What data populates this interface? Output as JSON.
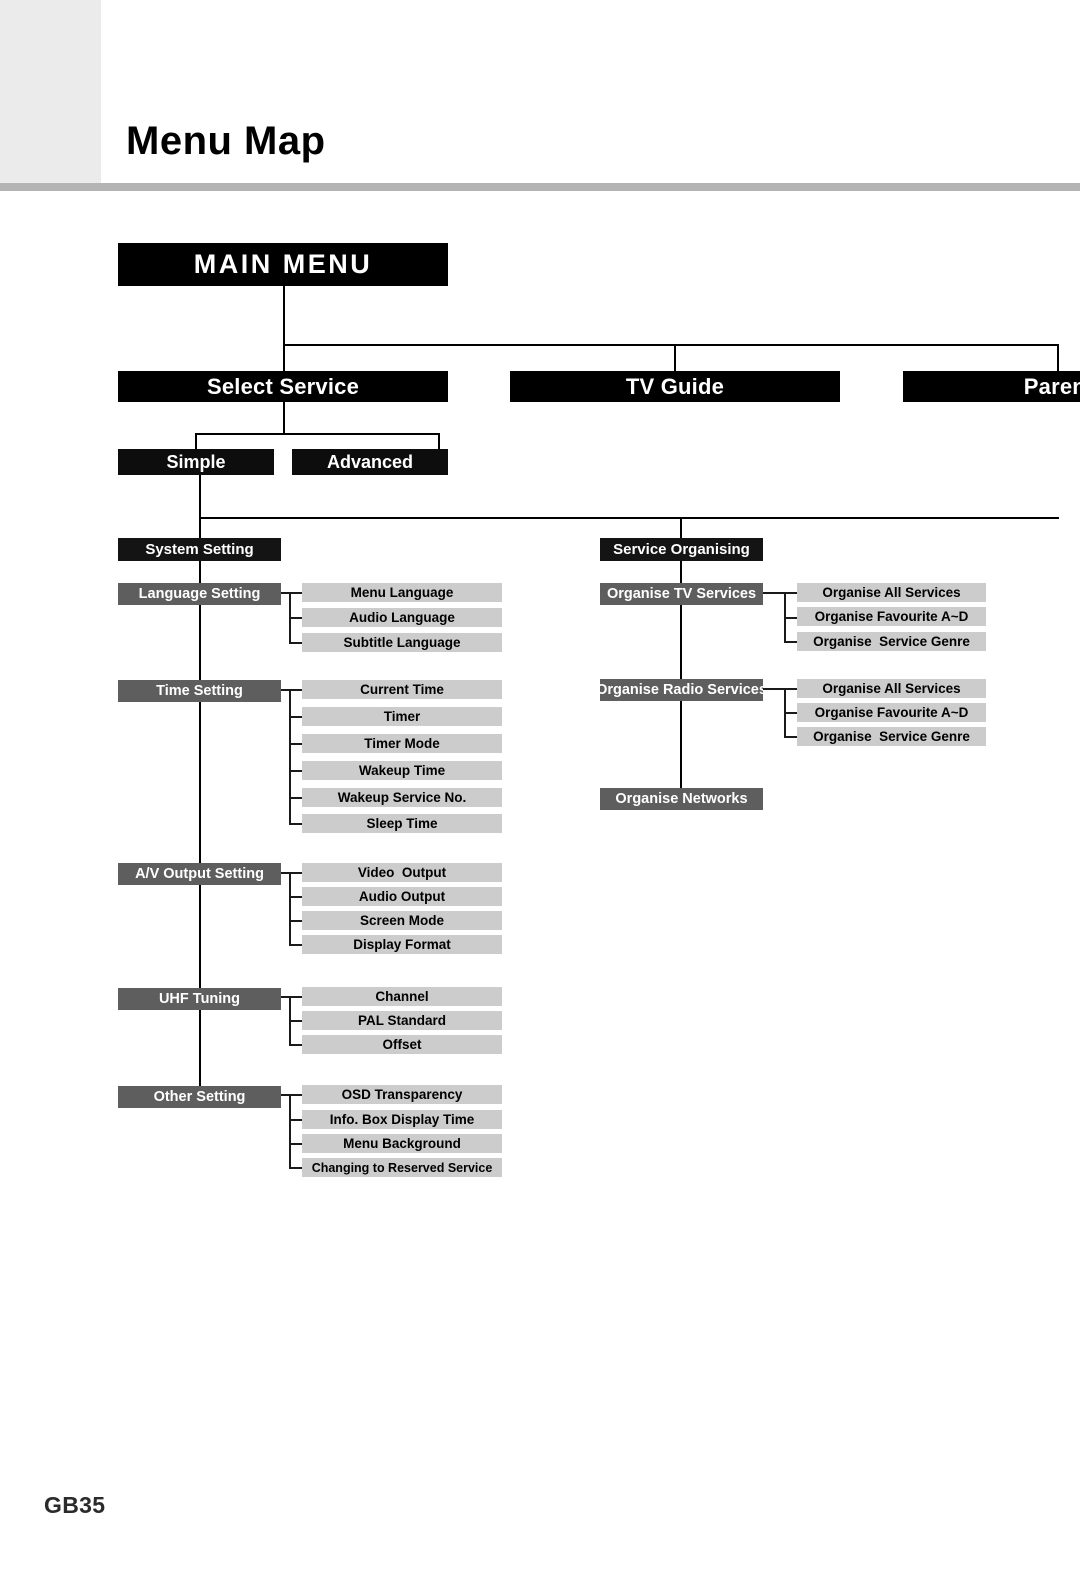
{
  "page": {
    "title": "Menu Map",
    "page_number": "GB35"
  },
  "tree": {
    "root": {
      "label": "MAIN MENU"
    },
    "level1": [
      {
        "label": "Select Service"
      },
      {
        "label": "TV Guide"
      },
      {
        "label": "Parental"
      }
    ],
    "select_service_children": [
      {
        "label": "Simple"
      },
      {
        "label": "Advanced"
      }
    ],
    "sections": [
      {
        "label": "System Setting",
        "groups": [
          {
            "label": "Language Setting",
            "items": [
              "Menu Language",
              "Audio Language",
              "Subtitle Language"
            ]
          },
          {
            "label": "Time Setting",
            "items": [
              "Current Time",
              "Timer",
              "Timer Mode",
              "Wakeup Time",
              "Wakeup Service No.",
              "Sleep Time"
            ]
          },
          {
            "label": "A/V Output Setting",
            "items": [
              "Video  Output",
              "Audio Output",
              "Screen Mode",
              "Display Format"
            ]
          },
          {
            "label": "UHF Tuning",
            "items": [
              "Channel",
              "PAL Standard",
              "Offset"
            ]
          },
          {
            "label": "Other Setting",
            "items": [
              "OSD Transparency",
              "Info. Box Display Time",
              "Menu Background",
              "Changing to Reserved Service"
            ]
          }
        ]
      },
      {
        "label": "Service Organising",
        "groups": [
          {
            "label": "Organise TV Services",
            "items": [
              "Organise All Services",
              "Organise Favourite A~D",
              "Organise  Service Genre"
            ]
          },
          {
            "label": "Organise Radio Services",
            "items": [
              "Organise All Services",
              "Organise Favourite A~D",
              "Organise  Service Genre"
            ]
          },
          {
            "label": "Organise Networks",
            "items": []
          }
        ]
      }
    ]
  },
  "colors": {
    "root_bg": "#000000",
    "section_bg": "#141414",
    "category_bg": "#5e5e5e",
    "leaf_bg": "#cccccc",
    "rule": "#b4b4b4",
    "corner": "#ebebeb"
  }
}
